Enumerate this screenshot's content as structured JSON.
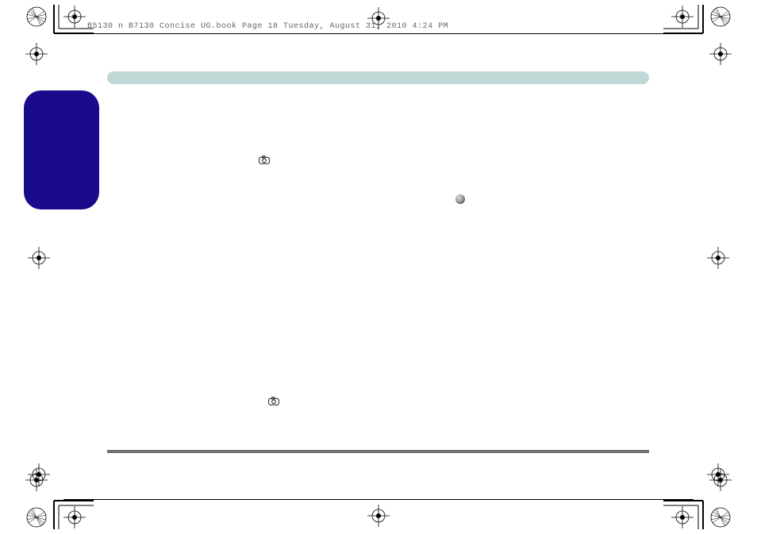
{
  "header": {
    "stamp": "B5130 n B7130 Concise UG.book  Page 18  Tuesday, August 31, 2010  4:24 PM"
  },
  "icons": {
    "camera1": "camera-icon",
    "camera2": "camera-icon",
    "globe": "globe-icon"
  }
}
